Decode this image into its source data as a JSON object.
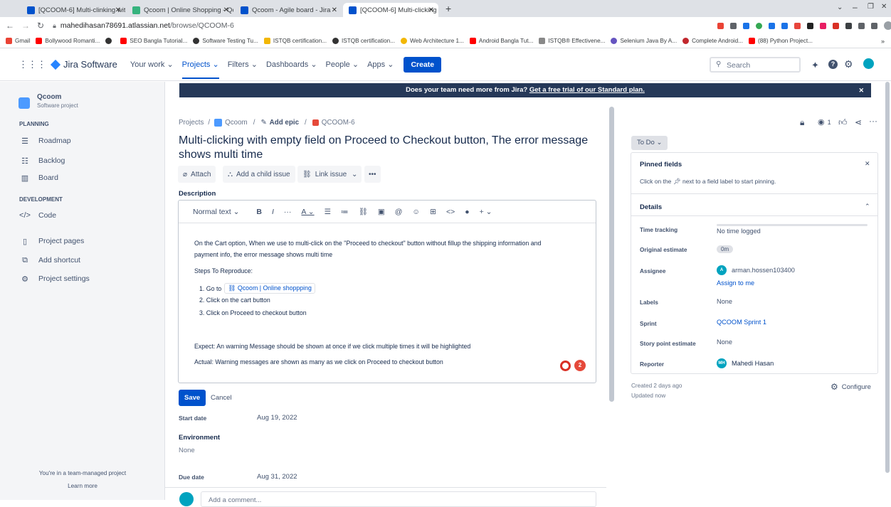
{
  "browser": {
    "tabs": [
      {
        "title": "[QCOOM-6] Multi-clinking with",
        "color": "#0052cc"
      },
      {
        "title": "Qcoom | Online Shopping - Qco",
        "color": "#36b37e"
      },
      {
        "title": "Qcoom - Agile board - Jira",
        "color": "#0052cc"
      },
      {
        "title": "[QCOOM-6] Multi-clicking with",
        "color": "#0052cc"
      }
    ],
    "url_host": "mahedihasan78691.atlassian.net",
    "url_path": "/browse/QCOOM-6",
    "bookmarks": [
      {
        "label": "Gmail",
        "color": "#ea4335"
      },
      {
        "label": "Bollywood Romanti...",
        "color": "#ff0000"
      },
      {
        "label": "",
        "color": "#333333"
      },
      {
        "label": "SEO Bangla Tutorial...",
        "color": "#ff0000"
      },
      {
        "label": "Software Testing Tu...",
        "color": "#333333"
      },
      {
        "label": "ISTQB certification...",
        "color": "#f2b705"
      },
      {
        "label": "ISTQB certification...",
        "color": "#333333"
      },
      {
        "label": "Web Architecture 1...",
        "color": "#f2b705"
      },
      {
        "label": "Android Bangla Tut...",
        "color": "#ff0000"
      },
      {
        "label": "ISTQB® Effectivene...",
        "color": "#888888"
      },
      {
        "label": "Selenium Java By A...",
        "color": "#6554c0"
      },
      {
        "label": "Complete Android...",
        "color": "#c1272d"
      },
      {
        "label": "(88) Python Project...",
        "color": "#ff0000"
      }
    ]
  },
  "nav": {
    "logo": "Jira Software",
    "items": [
      "Your work",
      "Projects",
      "Filters",
      "Dashboards",
      "People",
      "Apps"
    ],
    "create": "Create",
    "search_placeholder": "Search"
  },
  "sidebar": {
    "project_name": "Qcoom",
    "project_type": "Software project",
    "planning_head": "PLANNING",
    "planning": [
      "Roadmap",
      "Backlog",
      "Board"
    ],
    "development_head": "DEVELOPMENT",
    "code": "Code",
    "project_pages": "Project pages",
    "add_shortcut": "Add shortcut",
    "project_settings": "Project settings",
    "footer": "You're in a team-managed project",
    "learn_more": "Learn more"
  },
  "banner": {
    "text": "Does your team need more from Jira?",
    "link": "Get a free trial of our Standard plan."
  },
  "issue": {
    "crumb_projects": "Projects",
    "crumb_project": "Qcoom",
    "crumb_epic": "Add epic",
    "crumb_key": "QCOOM-6",
    "title_line1": "Multi-clicking with empty field on Proceed to Checkout button, The error message",
    "title_line2": "shows multi time",
    "attach": "Attach",
    "add_child": "Add a child issue",
    "link_issue": "Link issue",
    "description_label": "Description",
    "text_style": "Normal text",
    "desc_p1a": "On the Cart option, When we use to multi-click on the \"Proceed to checkout\" button without fillup the shipping information and",
    "desc_p1b": "payment info, the error message shows multi time",
    "steps_head": "Steps To Reproduce:",
    "step1_prefix": "1. Go to",
    "step1_link": "Qcoom | Online shoppping",
    "step2": "2.  Click on the cart button",
    "step3": "3. Click on Proceed to checkout button",
    "expect": "Expect: An warning Message should be shown at once if we click multiple times it will be highlighted",
    "actual": "Actual: Warning messages are shown as many as we click on Proceed to checkout button",
    "save": "Save",
    "cancel": "Cancel",
    "start_date_label": "Start date",
    "start_date": "Aug 19, 2022",
    "environment_label": "Environment",
    "environment": "None",
    "due_date_label": "Due date",
    "due_date": "Aug 31, 2022",
    "comment_placeholder": "Add a comment..."
  },
  "panel": {
    "watch_count": "1",
    "status": "To Do",
    "pinned_title": "Pinned fields",
    "pinned_hint_a": "Click on the",
    "pinned_hint_b": "next to a field label to start pinning.",
    "details": "Details",
    "time_tracking_label": "Time tracking",
    "time_tracking": "No time logged",
    "estimate_label": "Original estimate",
    "estimate": "0m",
    "assignee_label": "Assignee",
    "assignee_initial": "A",
    "assignee": "arman.hossen103400",
    "assign_to_me": "Assign to me",
    "labels_label": "Labels",
    "labels": "None",
    "sprint_label": "Sprint",
    "sprint": "QCOOM Sprint 1",
    "story_label": "Story point estimate",
    "story": "None",
    "reporter_label": "Reporter",
    "reporter_initials": "MH",
    "reporter": "Mahedi Hasan",
    "created": "Created 2 days ago",
    "updated": "Updated now",
    "configure": "Configure"
  }
}
